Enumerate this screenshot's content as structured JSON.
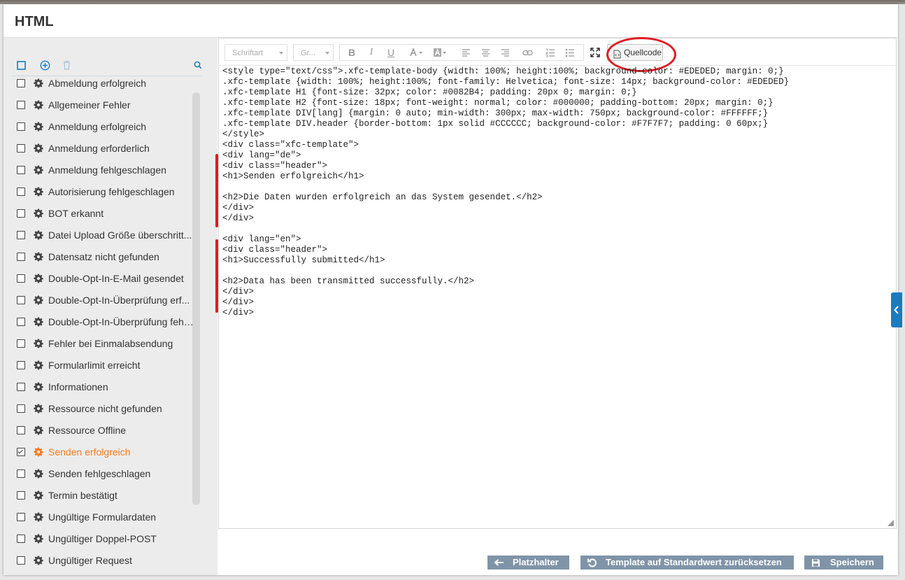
{
  "window": {
    "title": "HTML"
  },
  "left_tools": {
    "select_all": "checkbox-icon",
    "add": "plus-circle-icon",
    "delete": "trash-icon",
    "search": "search-icon"
  },
  "templates": [
    {
      "label": "Abmeldung erfolgreich",
      "checked": false,
      "active": false
    },
    {
      "label": "Allgemeiner Fehler",
      "checked": false,
      "active": false
    },
    {
      "label": "Anmeldung erfolgreich",
      "checked": false,
      "active": false
    },
    {
      "label": "Anmeldung erforderlich",
      "checked": false,
      "active": false
    },
    {
      "label": "Anmeldung fehlgeschlagen",
      "checked": false,
      "active": false
    },
    {
      "label": "Autorisierung fehlgeschlagen",
      "checked": false,
      "active": false
    },
    {
      "label": "BOT erkannt",
      "checked": false,
      "active": false
    },
    {
      "label": "Datei Upload Größe überschritt...",
      "checked": false,
      "active": false
    },
    {
      "label": "Datensatz nicht gefunden",
      "checked": false,
      "active": false
    },
    {
      "label": "Double-Opt-In-E-Mail gesendet",
      "checked": false,
      "active": false
    },
    {
      "label": "Double-Opt-In-Überprüfung erf...",
      "checked": false,
      "active": false
    },
    {
      "label": "Double-Opt-In-Überprüfung fehl...",
      "checked": false,
      "active": false
    },
    {
      "label": "Fehler bei Einmalabsendung",
      "checked": false,
      "active": false
    },
    {
      "label": "Formularlimit erreicht",
      "checked": false,
      "active": false
    },
    {
      "label": "Informationen",
      "checked": false,
      "active": false
    },
    {
      "label": "Ressource nicht gefunden",
      "checked": false,
      "active": false
    },
    {
      "label": "Ressource Offline",
      "checked": false,
      "active": false
    },
    {
      "label": "Senden erfolgreich",
      "checked": true,
      "active": true
    },
    {
      "label": "Senden fehlgeschlagen",
      "checked": false,
      "active": false
    },
    {
      "label": "Termin bestätigt",
      "checked": false,
      "active": false
    },
    {
      "label": "Ungültige Formulardaten",
      "checked": false,
      "active": false
    },
    {
      "label": "Ungültiger Doppel-POST",
      "checked": false,
      "active": false
    },
    {
      "label": "Ungültiger Request",
      "checked": false,
      "active": false
    }
  ],
  "toolbar": {
    "font_select": "Schriftart",
    "size_select": "Gr...",
    "source_button": "Quellcode"
  },
  "code_lines": [
    "<style type=\"text/css\">.xfc-template-body {width: 100%; height:100%; background-color: #EDEDED; margin: 0;}",
    ".xfc-template {width: 100%; height:100%; font-family: Helvetica; font-size: 14px; background-color: #EDEDED}",
    ".xfc-template H1 {font-size: 32px; color: #0082B4; padding: 20px 0; margin: 0;}",
    ".xfc-template H2 {font-size: 18px; font-weight: normal; color: #000000; padding-bottom: 20px; margin: 0;}",
    ".xfc-template DIV[lang] {margin: 0 auto; min-width: 300px; max-width: 750px; background-color: #FFFFFF;}",
    ".xfc-template DIV.header {border-bottom: 1px solid #CCCCCC; background-color: #F7F7F7; padding: 0 60px;}",
    "</style>",
    "<div class=\"xfc-template\">",
    "<div lang=\"de\">",
    "<div class=\"header\">",
    "<h1>Senden erfolgreich</h1>",
    "",
    "<h2>Die Daten wurden erfolgreich an das System gesendet.</h2>",
    "</div>",
    "</div>",
    "",
    "<div lang=\"en\">",
    "<div class=\"header\">",
    "<h1>Successfully submitted</h1>",
    "",
    "<h2>Data has been transmitted successfully.</h2>",
    "</div>",
    "</div>",
    "</div>"
  ],
  "footer": {
    "placeholder_button": "Platzhalter",
    "reset_button": "Template auf Standardwert zurücksetzen",
    "save_button": "Speichern"
  },
  "colors": {
    "accent": "#f47c20",
    "highlight": "#e01b24",
    "button": "#8094a8",
    "side_tab": "#1a7bbd"
  }
}
